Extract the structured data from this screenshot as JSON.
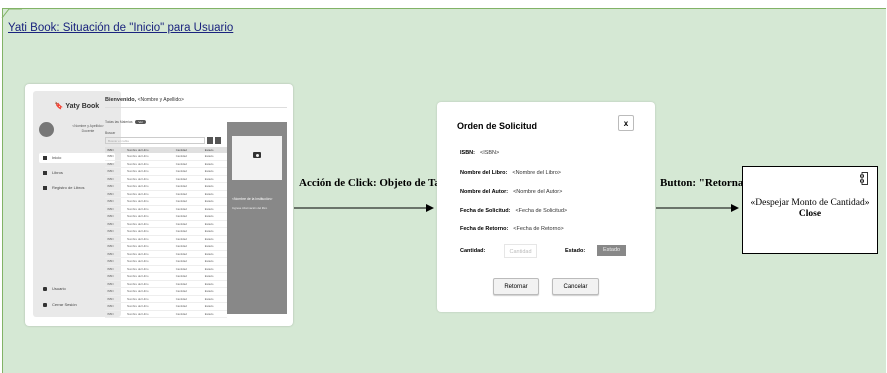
{
  "diagram_title": "Yati Book: Situación de \"Inicio\" para Usuario",
  "mockup_home": {
    "brand": "Yaty Book",
    "user_name": "<Nombre y Apellido>",
    "user_role": "Docente",
    "nav": [
      "Inicio",
      "Libros",
      "Registro de Libros"
    ],
    "footer_nav": [
      "Usuario",
      "Cerrar Sesión"
    ],
    "welcome_bold": "Bienvenido,",
    "welcome_name": "<Nombre y Apellido>",
    "filter_label": "Todas las Materias",
    "filter_chip": "Ver",
    "search_label": "Buscar",
    "search_placeholder": "Buscar en tabla",
    "table_headers": [
      "ISBN",
      "Nombre del Libro",
      "Cantidad",
      "Estado"
    ],
    "table_row": [
      "ISBN",
      "Nombre del Libro",
      "Cantidad",
      "Estado"
    ],
    "table_row_count": 22,
    "panel_title": "<Nombre de la Institución>",
    "panel_subtitle": "Ingrese información del libro"
  },
  "arrow_left_label": "Acción de Click: Objeto de Tabla",
  "arrow_right_label": "Button: \"Retornar\"",
  "modal": {
    "title": "Orden de Solicitud",
    "close_label": "x",
    "fields": [
      {
        "label": "ISBN:",
        "value": "<ISBN>"
      },
      {
        "label": "Nombre del Libro:",
        "value": "<Nombre del Libro>"
      },
      {
        "label": "Nombre del Autor:",
        "value": "<Nombre del Autor>"
      },
      {
        "label": "Fecha de Solicitud:",
        "value": "<Fecha de Solicitud>"
      },
      {
        "label": "Fecha de Retorno:",
        "value": "<Fecha de Retorno>"
      }
    ],
    "cantidad_label": "Cantidad:",
    "cantidad_placeholder": "Cantidad",
    "estado_label": "Estado:",
    "estado_value": "Estado",
    "retornar_label": "Retornar",
    "cancelar_label": "Cancelar"
  },
  "component": {
    "line1": "«Despejar Monto de Cantidad»",
    "line2": "Close"
  },
  "colors": {
    "frame_fill": "#d5e8d4",
    "frame_border": "#82b366"
  },
  "icons": [
    "bookmark-icon",
    "camera-icon",
    "component-icon",
    "home-icon",
    "book-icon",
    "user-icon",
    "logout-icon"
  ]
}
